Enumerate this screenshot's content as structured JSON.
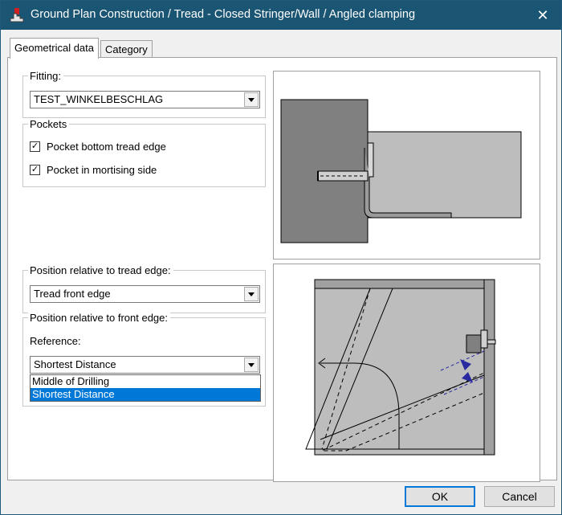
{
  "window": {
    "title": "Ground Plan Construction / Tread - Closed Stringer/Wall / Angled clamping",
    "close_glyph": "✕"
  },
  "tabs": [
    {
      "label": "Geometrical data"
    },
    {
      "label": "Category"
    }
  ],
  "fitting": {
    "group_label": "Fitting:",
    "value": "TEST_WINKELBESCHLAG"
  },
  "pockets": {
    "group_label": "Pockets",
    "items": [
      {
        "label": "Pocket bottom tread edge",
        "checked": true,
        "mark": "✓"
      },
      {
        "label": "Pocket in mortising side",
        "checked": true,
        "mark": "✓"
      }
    ]
  },
  "position_tread_edge": {
    "group_label": "Position relative to tread edge:",
    "value": "Tread front edge"
  },
  "position_front_edge": {
    "group_label": "Position relative to front edge:",
    "reference_label": "Reference:",
    "value": "Shortest Distance",
    "options": [
      {
        "label": "Middle of Drilling"
      },
      {
        "label": "Shortest Distance"
      }
    ]
  },
  "buttons": {
    "ok": "OK",
    "cancel": "Cancel"
  },
  "colors": {
    "titlebar": "#1b5574",
    "selection": "#0078d7",
    "drawing_fill": "#bdbdbd",
    "drawing_dark": "#808080",
    "arrow_blue": "#2828a0"
  }
}
